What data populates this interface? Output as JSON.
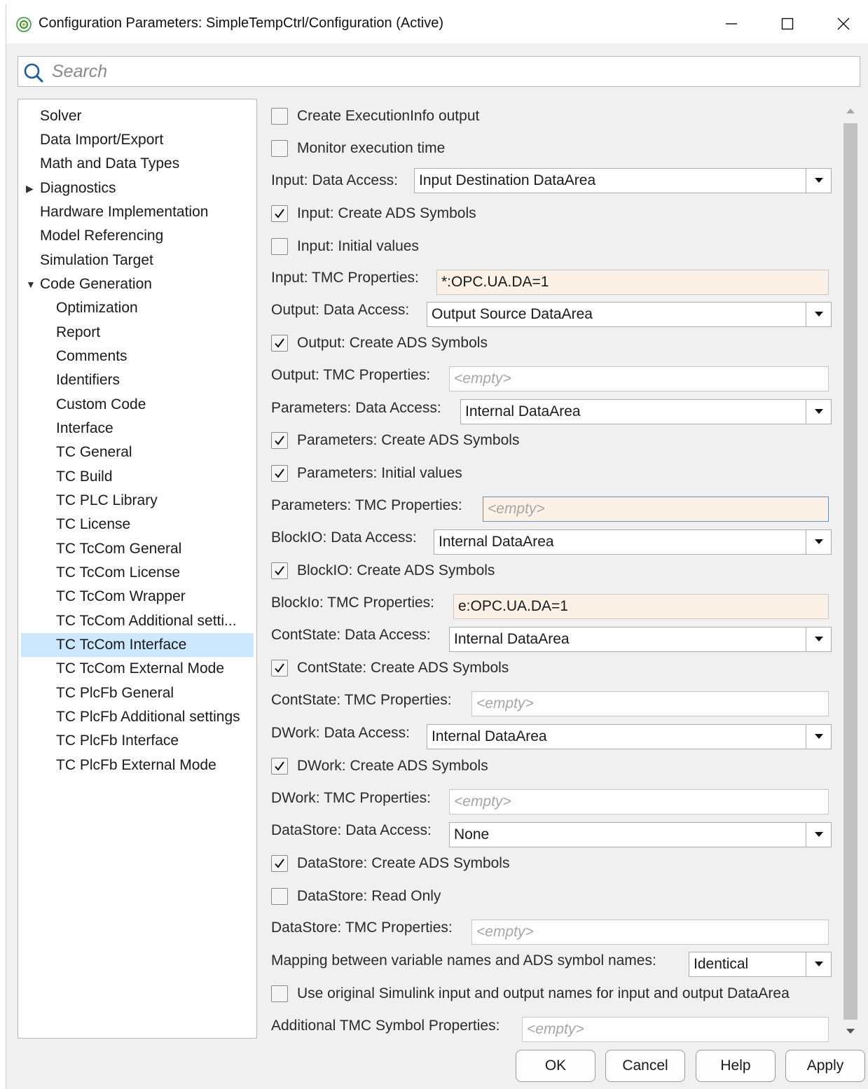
{
  "window": {
    "title": "Configuration Parameters: SimpleTempCtrl/Configuration (Active)",
    "minimize_glyph": "—",
    "maximize_glyph": "☐",
    "close_glyph": "✕"
  },
  "search": {
    "placeholder": "Search",
    "value": ""
  },
  "tree": {
    "items": [
      {
        "label": "Solver"
      },
      {
        "label": "Data Import/Export"
      },
      {
        "label": "Math and Data Types"
      },
      {
        "label": "Diagnostics",
        "arrow": "▶"
      },
      {
        "label": "Hardware Implementation"
      },
      {
        "label": "Model Referencing"
      },
      {
        "label": "Simulation Target"
      },
      {
        "label": "Code Generation",
        "arrow": "▼"
      },
      {
        "label": "Optimization"
      },
      {
        "label": "Report"
      },
      {
        "label": "Comments"
      },
      {
        "label": "Identifiers"
      },
      {
        "label": "Custom Code"
      },
      {
        "label": "Interface"
      },
      {
        "label": "TC General"
      },
      {
        "label": "TC Build"
      },
      {
        "label": "TC PLC Library"
      },
      {
        "label": "TC License"
      },
      {
        "label": "TC TcCom General"
      },
      {
        "label": "TC TcCom License"
      },
      {
        "label": "TC TcCom Wrapper"
      },
      {
        "label": "TC TcCom Additional setti..."
      },
      {
        "label": "TC TcCom Interface"
      },
      {
        "label": "TC TcCom External Mode"
      },
      {
        "label": "TC PlcFb General"
      },
      {
        "label": "TC PlcFb Additional settings"
      },
      {
        "label": "TC PlcFb Interface"
      },
      {
        "label": "TC PlcFb External Mode"
      }
    ]
  },
  "settings": {
    "create_executioninfo": {
      "label": "Create ExecutionInfo output",
      "checked": false
    },
    "monitor_execution_time": {
      "label": "Monitor execution time",
      "checked": false
    },
    "input_data_access": {
      "label": "Input: Data Access:",
      "value": "Input Destination DataArea"
    },
    "input_create_ads": {
      "label": "Input: Create ADS Symbols",
      "checked": true
    },
    "input_initial_values": {
      "label": "Input: Initial values",
      "checked": false
    },
    "input_tmc": {
      "label": "Input: TMC Properties:",
      "value": "*:OPC.UA.DA=1"
    },
    "output_data_access": {
      "label": "Output: Data Access:",
      "value": "Output Source DataArea"
    },
    "output_create_ads": {
      "label": "Output: Create ADS Symbols",
      "checked": true
    },
    "output_tmc": {
      "label": "Output: TMC Properties:",
      "value": "<empty>"
    },
    "parameters_data_access": {
      "label": "Parameters: Data Access:",
      "value": "Internal DataArea"
    },
    "parameters_create_ads": {
      "label": "Parameters: Create ADS Symbols",
      "checked": true
    },
    "parameters_initial_values": {
      "label": "Parameters: Initial values",
      "checked": true
    },
    "parameters_tmc": {
      "label": "Parameters: TMC Properties:",
      "value": "<empty>"
    },
    "blockio_data_access": {
      "label": "BlockIO: Data Access:",
      "value": "Internal DataArea"
    },
    "blockio_create_ads": {
      "label": "BlockIO: Create ADS Symbols",
      "checked": true
    },
    "blockio_tmc": {
      "label": "BlockIo: TMC Properties:",
      "value": "e:OPC.UA.DA=1"
    },
    "contstate_data_access": {
      "label": "ContState: Data Access:",
      "value": "Internal DataArea"
    },
    "contstate_create_ads": {
      "label": "ContState: Create ADS Symbols",
      "checked": true
    },
    "contstate_tmc": {
      "label": "ContState: TMC Properties:",
      "value": "<empty>"
    },
    "dwork_data_access": {
      "label": "DWork: Data Access:",
      "value": "Internal DataArea"
    },
    "dwork_create_ads": {
      "label": "DWork: Create ADS Symbols",
      "checked": true
    },
    "dwork_tmc": {
      "label": "DWork: TMC Properties:",
      "value": "<empty>"
    },
    "datastore_data_access": {
      "label": "DataStore: Data Access:",
      "value": "None"
    },
    "datastore_create_ads": {
      "label": "DataStore: Create ADS Symbols",
      "checked": true
    },
    "datastore_read_only": {
      "label": "DataStore: Read Only",
      "checked": false
    },
    "datastore_tmc": {
      "label": "DataStore: TMC Properties:",
      "value": "<empty>"
    },
    "mapping": {
      "label": "Mapping between variable names and ADS symbol names:",
      "value": "Identical"
    },
    "use_original_names": {
      "label": "Use original Simulink input and output names for input and output DataArea",
      "checked": false
    },
    "additional_tmc": {
      "label": "Additional TMC Symbol Properties:",
      "value": "<empty>"
    }
  },
  "buttons": {
    "ok": "OK",
    "cancel": "Cancel",
    "help": "Help",
    "apply": "Apply"
  },
  "colors": {
    "selection": "#cce8ff",
    "tinted_field": "#fcf1e6",
    "window_bg": "#f0f0f0",
    "icon_green": "#3f8f3f"
  }
}
